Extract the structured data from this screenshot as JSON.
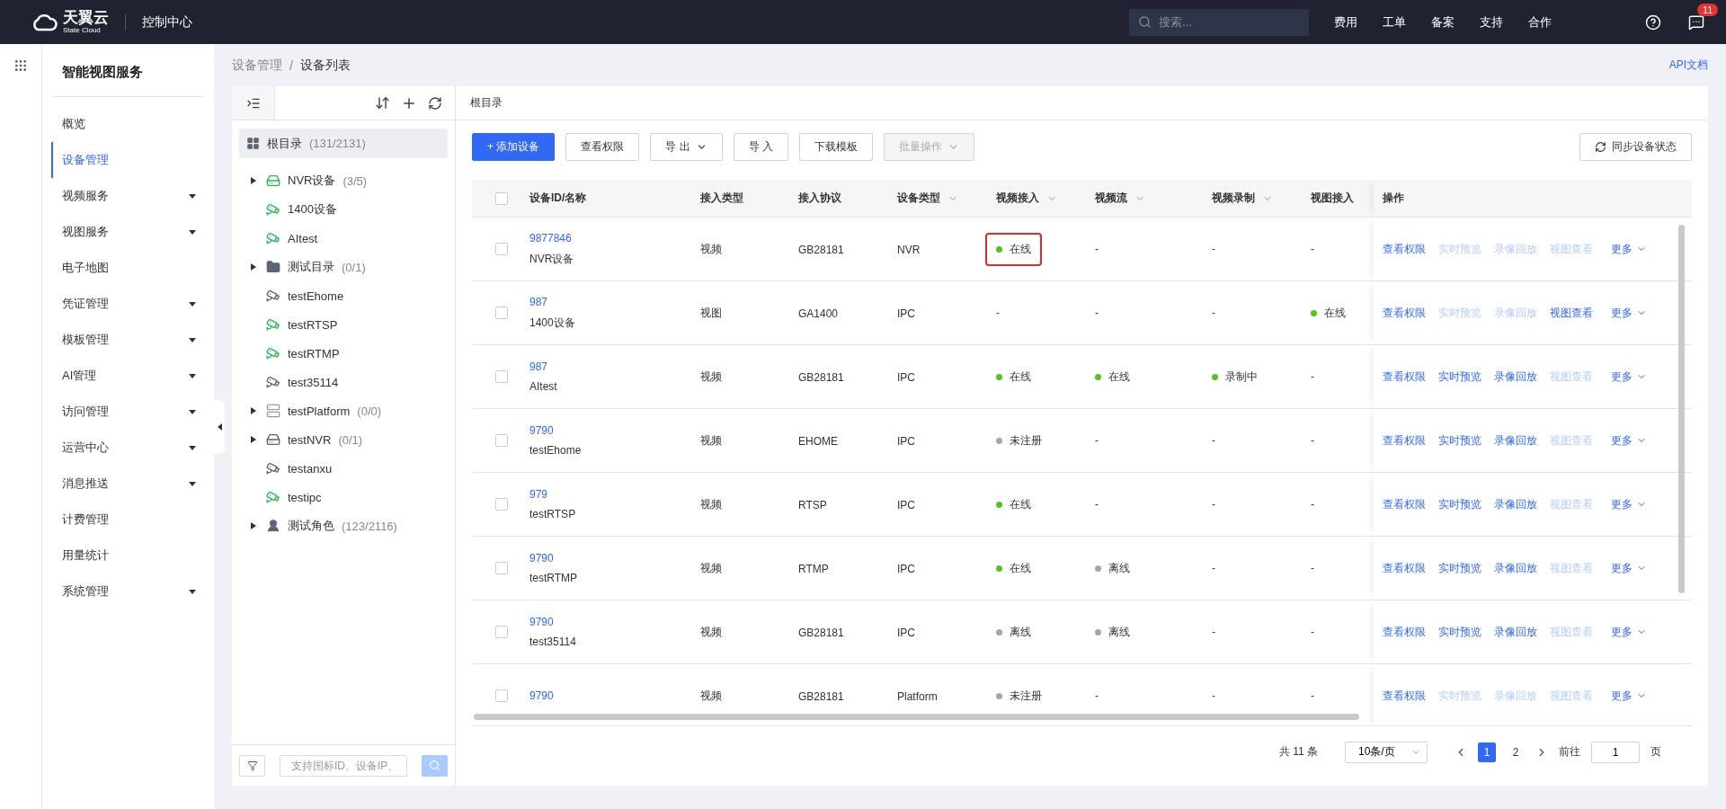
{
  "topbar": {
    "logo_name": "天翼云",
    "logo_sub": "State Cloud",
    "title": "控制中心",
    "search": {
      "placeholder": "搜索..."
    },
    "nav": [
      "费用",
      "工单",
      "备案",
      "支持",
      "合作"
    ],
    "notifications": "11"
  },
  "sidebar": {
    "title": "智能视图服务",
    "items": [
      {
        "label": "概览",
        "selected": false,
        "expandable": false
      },
      {
        "label": "设备管理",
        "selected": true,
        "expandable": false
      },
      {
        "label": "视频服务",
        "selected": false,
        "expandable": true
      },
      {
        "label": "视图服务",
        "selected": false,
        "expandable": true
      },
      {
        "label": "电子地图",
        "selected": false,
        "expandable": false
      },
      {
        "label": "凭证管理",
        "selected": false,
        "expandable": true
      },
      {
        "label": "模板管理",
        "selected": false,
        "expandable": true
      },
      {
        "label": "AI管理",
        "selected": false,
        "expandable": true
      },
      {
        "label": "访问管理",
        "selected": false,
        "expandable": true
      },
      {
        "label": "运营中心",
        "selected": false,
        "expandable": true
      },
      {
        "label": "消息推送",
        "selected": false,
        "expandable": true
      },
      {
        "label": "计费管理",
        "selected": false,
        "expandable": false
      },
      {
        "label": "用量统计",
        "selected": false,
        "expandable": false
      },
      {
        "label": "系统管理",
        "selected": false,
        "expandable": true
      }
    ]
  },
  "breadcrumb": [
    "设备管理",
    "设备列表"
  ],
  "breadcrumb_separator": "/",
  "api_link": "API文档",
  "tree": {
    "root": {
      "label": "根目录",
      "count": "(131/2131)",
      "selected": true
    },
    "items": [
      {
        "kind": "nvr",
        "label": "NVR设备",
        "count": "(3/5)",
        "expandable": true,
        "online": true
      },
      {
        "kind": "camera",
        "label": "1400设备",
        "expandable": false,
        "online": true
      },
      {
        "kind": "camera",
        "label": "AItest",
        "expandable": false,
        "online": true
      },
      {
        "kind": "folder",
        "label": "测试目录",
        "count": "(0/1)",
        "expandable": true,
        "online": false
      },
      {
        "kind": "camera",
        "label": "testEhome",
        "expandable": false,
        "online": false
      },
      {
        "kind": "camera",
        "label": "testRTSP",
        "expandable": false,
        "online": true
      },
      {
        "kind": "camera",
        "label": "testRTMP",
        "expandable": false,
        "online": true
      },
      {
        "kind": "camera",
        "label": "test35114",
        "expandable": false,
        "online": false
      },
      {
        "kind": "platform",
        "label": "testPlatform",
        "count": "(0/0)",
        "expandable": true,
        "online": false
      },
      {
        "kind": "nvr",
        "label": "testNVR",
        "count": "(0/1)",
        "expandable": true,
        "online": false
      },
      {
        "kind": "camera",
        "label": "testanxu",
        "expandable": false,
        "online": false
      },
      {
        "kind": "camera",
        "label": "testipc",
        "expandable": false,
        "online": true
      },
      {
        "kind": "role",
        "label": "测试角色",
        "count": "(123/2116)",
        "expandable": true,
        "online": false
      }
    ],
    "search": {
      "placeholder": "支持国标ID、设备IP、"
    }
  },
  "panel_title": "根目录",
  "toolbar": [
    {
      "label": "+ 添加设备",
      "kind": "primary",
      "dropdown": false,
      "disabled": false
    },
    {
      "label": "查看权限",
      "kind": "default",
      "dropdown": false,
      "disabled": false
    },
    {
      "label": "导 出",
      "kind": "default",
      "dropdown": true,
      "disabled": false
    },
    {
      "label": "导 入",
      "kind": "default",
      "dropdown": false,
      "disabled": false
    },
    {
      "label": "下载模板",
      "kind": "default",
      "dropdown": false,
      "disabled": false
    },
    {
      "label": "批量操作",
      "kind": "default",
      "dropdown": true,
      "disabled": true
    }
  ],
  "sync_button": "同步设备状态",
  "table": {
    "select_all": false,
    "columns": [
      {
        "label": "设备ID/名称",
        "filterable": false
      },
      {
        "label": "接入类型",
        "filterable": false
      },
      {
        "label": "接入协议",
        "filterable": false
      },
      {
        "label": "设备类型",
        "filterable": true
      },
      {
        "label": "视频接入",
        "filterable": true
      },
      {
        "label": "视频流",
        "filterable": true
      },
      {
        "label": "视频录制",
        "filterable": true
      },
      {
        "label": "视图接入",
        "filterable": false
      },
      {
        "label": "操作",
        "filterable": false
      }
    ],
    "rows": [
      {
        "checked": false,
        "id": "9877846",
        "name": "NVR设备",
        "type": "视频",
        "protocol": "GB28181",
        "device_type": "NVR",
        "status": [
          {
            "text": "在线",
            "color": "#52c41a",
            "highlighted": true
          },
          {
            "text": "-"
          },
          {
            "text": "-"
          },
          {
            "text": "-"
          }
        ],
        "actions": [
          {
            "label": "查看权限",
            "disabled": false
          },
          {
            "label": "实时预览",
            "disabled": true
          },
          {
            "label": "录像回放",
            "disabled": true
          },
          {
            "label": "视图查看",
            "disabled": true
          },
          {
            "label": "更多",
            "disabled": false
          }
        ]
      },
      {
        "checked": false,
        "id": "987",
        "name": "1400设备",
        "type": "视图",
        "protocol": "GA1400",
        "device_type": "IPC",
        "status": [
          {
            "text": "-"
          },
          {
            "text": "-"
          },
          {
            "text": "-"
          },
          {
            "text": "在线",
            "color": "#52c41a"
          }
        ],
        "actions": [
          {
            "label": "查看权限",
            "disabled": false
          },
          {
            "label": "实时预览",
            "disabled": true
          },
          {
            "label": "录像回放",
            "disabled": true
          },
          {
            "label": "视图查看",
            "disabled": false
          },
          {
            "label": "更多",
            "disabled": false
          }
        ]
      },
      {
        "checked": false,
        "id": "987",
        "name": "AItest",
        "type": "视频",
        "protocol": "GB28181",
        "device_type": "IPC",
        "status": [
          {
            "text": "在线",
            "color": "#52c41a"
          },
          {
            "text": "在线",
            "color": "#52c41a"
          },
          {
            "text": "录制中",
            "color": "#52c41a"
          },
          {
            "text": "-"
          }
        ],
        "actions": [
          {
            "label": "查看权限",
            "disabled": false
          },
          {
            "label": "实时预览",
            "disabled": false
          },
          {
            "label": "录像回放",
            "disabled": false
          },
          {
            "label": "视图查看",
            "disabled": true
          },
          {
            "label": "更多",
            "disabled": false
          }
        ]
      },
      {
        "checked": false,
        "id": "9790",
        "name": "testEhome",
        "type": "视频",
        "protocol": "EHOME",
        "device_type": "IPC",
        "status": [
          {
            "text": "未注册",
            "color": "#a6a6a6"
          },
          {
            "text": "-"
          },
          {
            "text": "-"
          },
          {
            "text": "-"
          }
        ],
        "actions": [
          {
            "label": "查看权限",
            "disabled": false
          },
          {
            "label": "实时预览",
            "disabled": false
          },
          {
            "label": "录像回放",
            "disabled": false
          },
          {
            "label": "视图查看",
            "disabled": true
          },
          {
            "label": "更多",
            "disabled": false
          }
        ]
      },
      {
        "checked": false,
        "id": "979",
        "name": "testRTSP",
        "type": "视频",
        "protocol": "RTSP",
        "device_type": "IPC",
        "status": [
          {
            "text": "在线",
            "color": "#52c41a"
          },
          {
            "text": "-"
          },
          {
            "text": "-"
          },
          {
            "text": "-"
          }
        ],
        "actions": [
          {
            "label": "查看权限",
            "disabled": false
          },
          {
            "label": "实时预览",
            "disabled": false
          },
          {
            "label": "录像回放",
            "disabled": false
          },
          {
            "label": "视图查看",
            "disabled": true
          },
          {
            "label": "更多",
            "disabled": false
          }
        ]
      },
      {
        "checked": false,
        "id": "9790",
        "name": "testRTMP",
        "type": "视频",
        "protocol": "RTMP",
        "device_type": "IPC",
        "status": [
          {
            "text": "在线",
            "color": "#52c41a"
          },
          {
            "text": "离线",
            "color": "#a6a6a6"
          },
          {
            "text": "-"
          },
          {
            "text": "-"
          }
        ],
        "actions": [
          {
            "label": "查看权限",
            "disabled": false
          },
          {
            "label": "实时预览",
            "disabled": false
          },
          {
            "label": "录像回放",
            "disabled": false
          },
          {
            "label": "视图查看",
            "disabled": true
          },
          {
            "label": "更多",
            "disabled": false
          }
        ]
      },
      {
        "checked": false,
        "id": "9790",
        "name": "test35114",
        "type": "视频",
        "protocol": "GB28181",
        "device_type": "IPC",
        "status": [
          {
            "text": "离线",
            "color": "#a6a6a6"
          },
          {
            "text": "离线",
            "color": "#a6a6a6"
          },
          {
            "text": "-"
          },
          {
            "text": "-"
          }
        ],
        "actions": [
          {
            "label": "查看权限",
            "disabled": false
          },
          {
            "label": "实时预览",
            "disabled": false
          },
          {
            "label": "录像回放",
            "disabled": false
          },
          {
            "label": "视图查看",
            "disabled": true
          },
          {
            "label": "更多",
            "disabled": false
          }
        ]
      },
      {
        "checked": false,
        "id": "9790",
        "type": "视频",
        "protocol": "GB28181",
        "device_type": "Platform",
        "status": [
          {
            "text": "未注册",
            "color": "#a6a6a6"
          },
          {
            "text": "-"
          },
          {
            "text": "-"
          },
          {
            "text": "-"
          }
        ],
        "actions": [
          {
            "label": "查看权限",
            "disabled": false
          },
          {
            "label": "实时预览",
            "disabled": true
          },
          {
            "label": "录像回放",
            "disabled": true
          },
          {
            "label": "视图查看",
            "disabled": true
          },
          {
            "label": "更多",
            "disabled": false
          }
        ]
      }
    ]
  },
  "pagination": {
    "total": "共 11 条",
    "page_size": "10条/页",
    "pages": [
      {
        "label": "1",
        "selected": true
      },
      {
        "label": "2",
        "selected": false
      }
    ],
    "goto_label": "前往",
    "goto_value": "1",
    "goto_suffix": "页"
  }
}
